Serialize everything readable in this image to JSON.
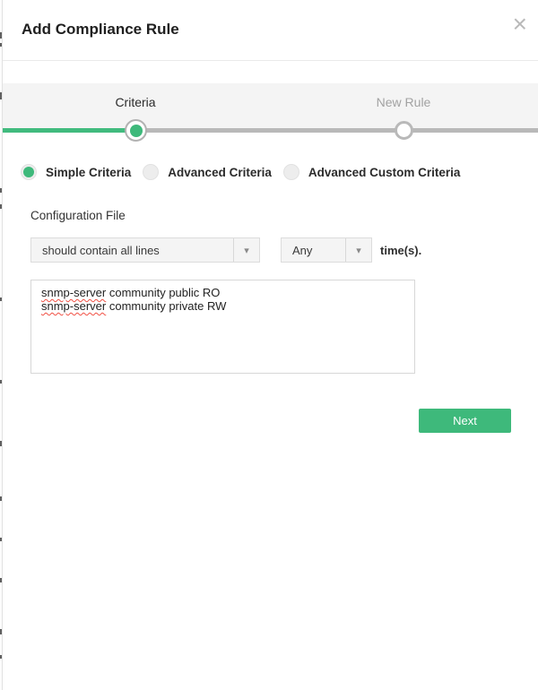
{
  "window": {
    "title": "Add Compliance Rule"
  },
  "icons": {
    "close": "×",
    "select_arrow": "▾"
  },
  "stepper": {
    "steps": [
      {
        "label": "Criteria",
        "state": "active"
      },
      {
        "label": "New Rule",
        "state": "pending"
      }
    ]
  },
  "criteria_options": [
    {
      "label": "Simple Criteria",
      "selected": true
    },
    {
      "label": "Advanced Criteria",
      "selected": false
    },
    {
      "label": "Advanced Custom Criteria",
      "selected": false
    }
  ],
  "form": {
    "section_label": "Configuration File",
    "condition_select": {
      "value": "should contain all lines"
    },
    "occurrence_select": {
      "value": "Any"
    },
    "occurrence_suffix": "time(s).",
    "config_lines": [
      {
        "keyword": "snmp-server",
        "rest": " community public RO"
      },
      {
        "keyword": "snmp-server",
        "rest": " community private RW"
      }
    ]
  },
  "actions": {
    "next": "Next"
  },
  "colors": {
    "accent_green": "#3eb97b",
    "progress_green": "#41bb7e",
    "step_track_gray": "#b9b9b9",
    "stepper_band_bg": "#f4f4f4",
    "misspell_red": "#f15044"
  }
}
